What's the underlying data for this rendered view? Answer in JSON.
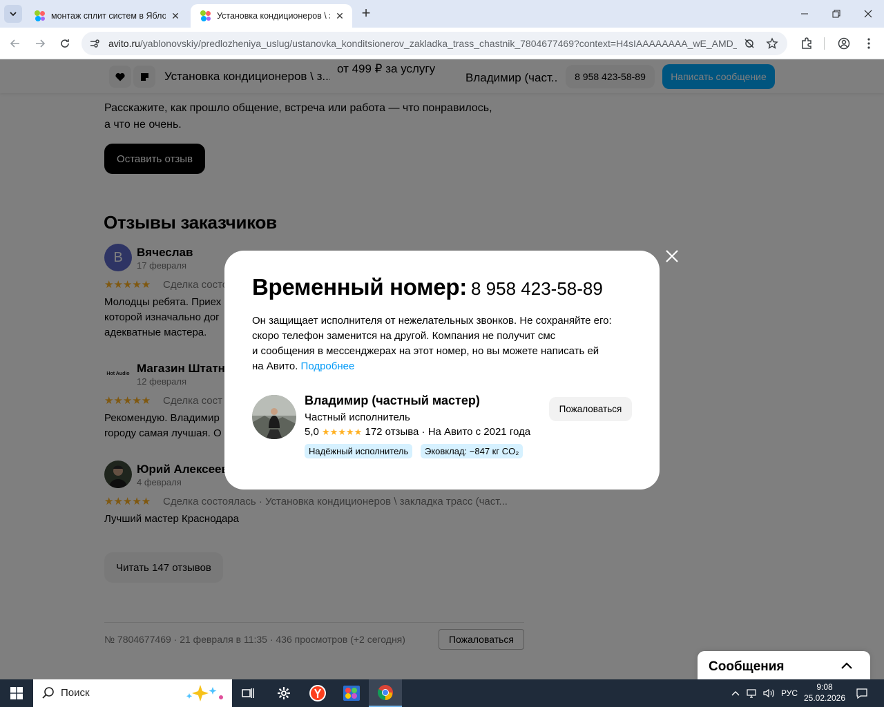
{
  "browser": {
    "tabs": [
      {
        "title": "монтаж сплит систем в Яблоно",
        "active": false
      },
      {
        "title": "Установка кондиционеров \\ за",
        "active": true
      }
    ],
    "address": {
      "host": "avito.ru",
      "path": "/yablonovskiy/predlozheniya_uslug/ustanovka_konditsionerov_zakladka_trass_chastnik_7804677469?context=H4sIAAAAAAAA_wE_AMD_Y..."
    }
  },
  "sticky": {
    "title": "Установка кондиционеров \\ з...",
    "price": "от 499 ₽ за услугу",
    "seller": "Владимир (част...",
    "phone": "8 958 423-58-89",
    "message_button": "Написать сообщение"
  },
  "page": {
    "review_prompt_line1": "Расскажите, как прошло общение, встреча или работа — что понравилось,",
    "review_prompt_line2": "а что не очень.",
    "leave_review_button": "Оставить отзыв",
    "reviews_heading": "Отзывы заказчиков",
    "reviews": [
      {
        "avatar_letter": "В",
        "name": "Вячеслав",
        "date": "17 февраля",
        "stars": "★★★★★",
        "meta": "Сделка состо",
        "lines": [
          "Молодцы ребята. Приех",
          "которой изначально дог",
          "адекватные мастера."
        ]
      },
      {
        "avatar_text": "Hot Audio",
        "name": "Магазин Штатн",
        "date": "12 февраля",
        "stars": "★★★★★",
        "meta": "Сделка сост",
        "lines": [
          "Рекомендую. Владимир",
          "городу самая лучшая. О"
        ]
      },
      {
        "name": "Юрий Алексеев",
        "date": "4 февраля",
        "stars": "★★★★★",
        "meta": "Сделка состоялась · Установка кондиционеров \\ закладка трасс (част...",
        "lines": [
          "Лучший мастер Краснодара"
        ]
      }
    ],
    "read_reviews_button": "Читать 147 отзывов",
    "footer_meta": "№ 7804677469 · 21 февраля в 11:35 · 436 просмотров (+2 сегодня)",
    "report_button": "Пожаловаться",
    "messages_panel": "Сообщения"
  },
  "modal": {
    "heading": "Временный номер:",
    "number": "8 958 423-58-89",
    "desc_line1": "Он защищает исполнителя от нежелательных звонков. Не сохраняйте его:",
    "desc_line2": "скоро телефон заменится на другой. Компания не получит смс",
    "desc_line3": "и сообщения в мессенджерах на этот номер, но вы можете написать ей",
    "desc_line4": "на Авито.",
    "desc_link": "Подробнее",
    "seller_name": "Владимир (частный мастер)",
    "seller_role": "Частный исполнитель",
    "rating": "5,0",
    "rating_stars": "★★★★★",
    "reviews_count": "172 отзыва",
    "since": "· На Авито с 2021 года",
    "badge_reliable": "Надёжный исполнитель",
    "badge_eco": "Эковклад: −847 кг CO₂",
    "report_button": "Пожаловаться"
  },
  "taskbar": {
    "search_placeholder": "Поиск",
    "lang": "РУС",
    "time": "9:08",
    "date": "25.02.2026"
  },
  "colors": {
    "accent_blue": "#00aaff",
    "link_blue": "#0099f7",
    "star_yellow": "#ffb021",
    "badge_bg": "#d6f1ff"
  }
}
